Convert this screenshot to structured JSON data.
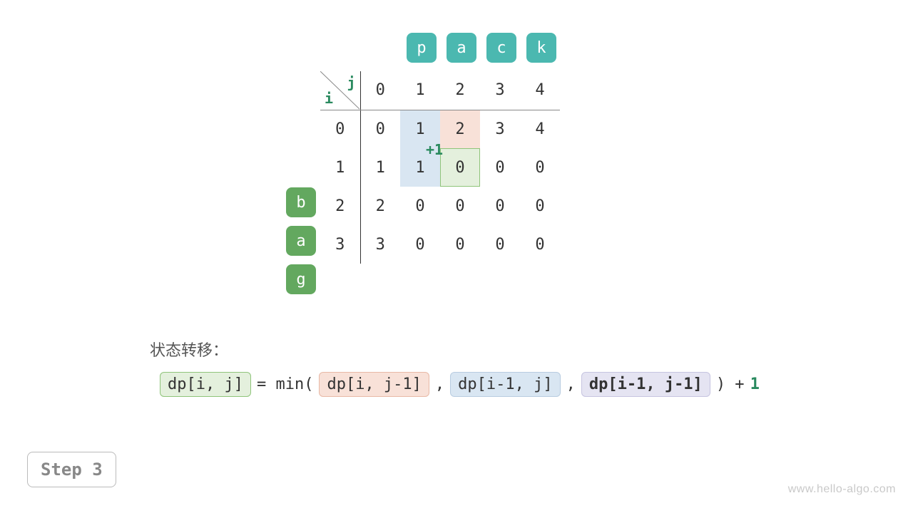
{
  "top_word": [
    "p",
    "a",
    "c",
    "k"
  ],
  "left_word": [
    "b",
    "a",
    "g"
  ],
  "axis": {
    "i": "i",
    "j": "j"
  },
  "col_headers": [
    "0",
    "1",
    "2",
    "3",
    "4"
  ],
  "row_headers": [
    "0",
    "1",
    "2",
    "3"
  ],
  "rows": [
    [
      {
        "v": "0",
        "faded": false,
        "bold": true
      },
      {
        "v": "1",
        "faded": false,
        "bold": false
      },
      {
        "v": "2",
        "faded": false,
        "bold": false
      },
      {
        "v": "3",
        "faded": false,
        "bold": false
      },
      {
        "v": "4",
        "faded": false,
        "bold": false
      }
    ],
    [
      {
        "v": "1",
        "faded": false,
        "bold": false
      },
      {
        "v": "1",
        "faded": false,
        "bold": true
      },
      {
        "v": "0",
        "faded": true,
        "bold": false
      },
      {
        "v": "0",
        "faded": true,
        "bold": false
      },
      {
        "v": "0",
        "faded": true,
        "bold": false
      }
    ],
    [
      {
        "v": "2",
        "faded": false,
        "bold": false
      },
      {
        "v": "0",
        "faded": true,
        "bold": false
      },
      {
        "v": "0",
        "faded": true,
        "bold": false
      },
      {
        "v": "0",
        "faded": true,
        "bold": false
      },
      {
        "v": "0",
        "faded": true,
        "bold": false
      }
    ],
    [
      {
        "v": "3",
        "faded": false,
        "bold": false
      },
      {
        "v": "0",
        "faded": true,
        "bold": false
      },
      {
        "v": "0",
        "faded": true,
        "bold": false
      },
      {
        "v": "0",
        "faded": true,
        "bold": false
      },
      {
        "v": "0",
        "faded": true,
        "bold": false
      }
    ]
  ],
  "plus1": "+1",
  "section_label": "状态转移：",
  "formula": {
    "lhs": "dp[i, j]",
    "eq": " = min( ",
    "a": "dp[i, j-1]",
    "sep1": " , ",
    "b": "dp[i-1, j]",
    "sep2": " , ",
    "c": "dp[i-1, j-1]",
    "close": " ) + ",
    "one": "1"
  },
  "step": "Step 3",
  "watermark": "www.hello-algo.com",
  "chart_data": {
    "type": "table",
    "title": "Edit distance DP table (Step 3)",
    "source": "bag",
    "target": "pack",
    "row_index": "i",
    "col_index": "j",
    "row_labels": [
      0,
      1,
      2,
      3
    ],
    "col_labels": [
      0,
      1,
      2,
      3,
      4
    ],
    "values": [
      [
        0,
        1,
        2,
        3,
        4
      ],
      [
        1,
        1,
        0,
        0,
        0
      ],
      [
        2,
        0,
        0,
        0,
        0
      ],
      [
        3,
        0,
        0,
        0,
        0
      ]
    ],
    "current_cell": {
      "i": 1,
      "j": 1,
      "value": 1
    },
    "highlighted_predecessors": [
      {
        "i": 0,
        "j": 0,
        "role": "dp[i-1,j-1]"
      },
      {
        "i": 0,
        "j": 1,
        "role": "dp[i,j-1]"
      },
      {
        "i": 1,
        "j": 0,
        "role": "dp[i-1,j]"
      }
    ],
    "transition": "dp[i,j] = min(dp[i,j-1], dp[i-1,j], dp[i-1,j-1]) + 1",
    "annotation": "+1"
  }
}
